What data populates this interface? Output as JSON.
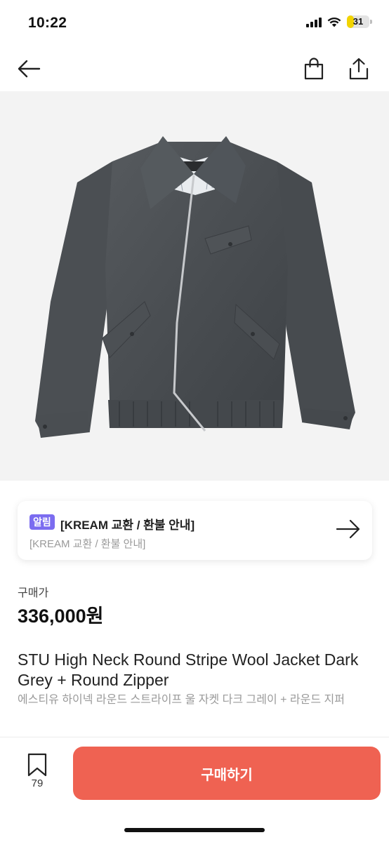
{
  "status_bar": {
    "time": "10:22",
    "battery_level": "31"
  },
  "nav": {
    "back_icon": "arrow-left-icon",
    "bag_icon": "shopping-bag-icon",
    "share_icon": "share-icon"
  },
  "notice": {
    "badge": "알림",
    "title": "[KREAM 교환 / 환불 안내]",
    "subtitle": "[KREAM 교환 / 환불 안내]",
    "arrow_icon": "arrow-right-icon"
  },
  "price": {
    "label": "구매가",
    "value": "336,000원"
  },
  "product": {
    "name": "STU High Neck Round Stripe Wool Jacket Dark Grey + Round Zipper",
    "name_ko": "에스티유 하이넥 라운드 스트라이프 울 자켓 다크 그레이 + 라운드 지퍼"
  },
  "bottom": {
    "bookmark_icon": "bookmark-icon",
    "bookmark_count": "79",
    "buy_label": "구매하기"
  },
  "colors": {
    "accent": "#ef6252",
    "badge": "#7b6cf0",
    "battery": "#f2d400"
  }
}
